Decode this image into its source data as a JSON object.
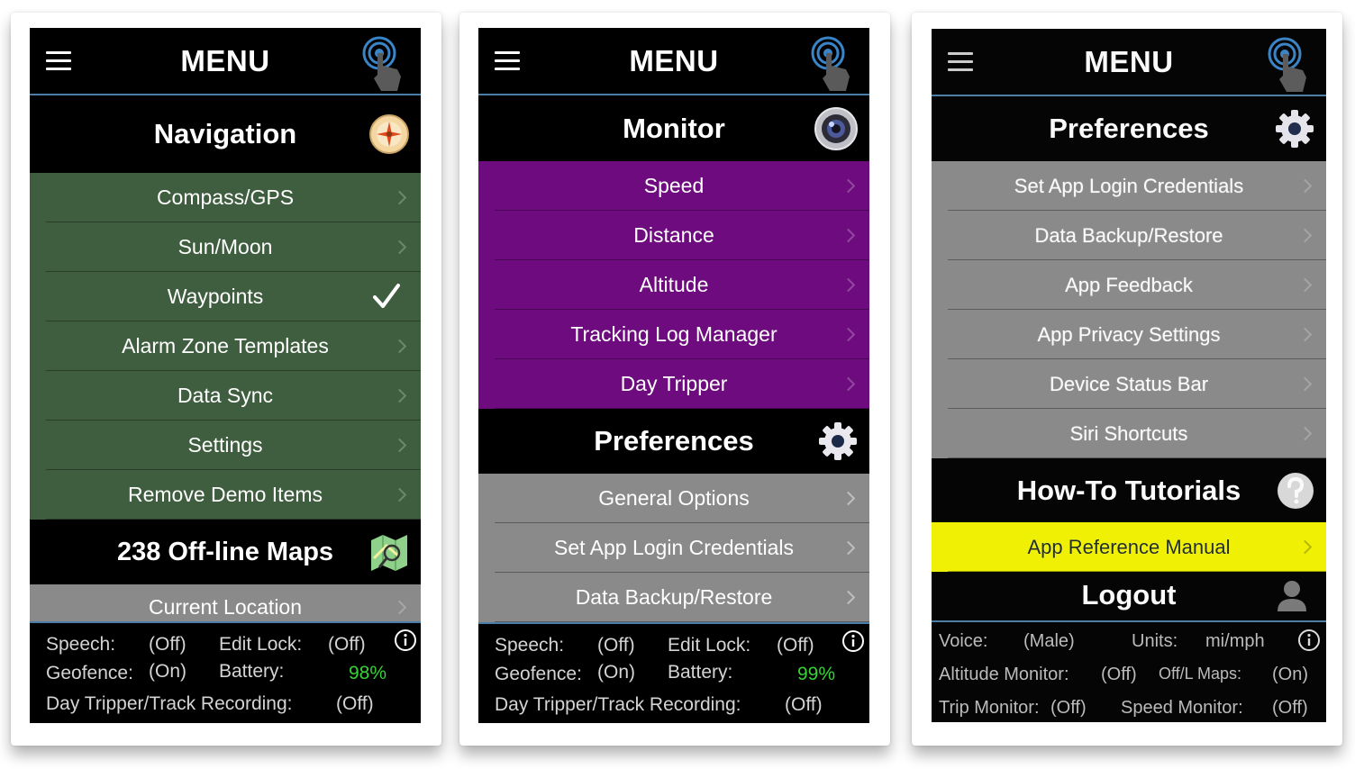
{
  "colors": {
    "navigation_rows": "#3f5e3f",
    "monitor_rows": "#6e0b7e",
    "preferences_rows": "#8a8a8a",
    "highlight_row": "#f5f500",
    "battery_text": "#36d236",
    "divider": "#4a7ea8"
  },
  "icons": {
    "menu": "hamburger-icon",
    "touch": "touch-pointer-icon",
    "navigation": "compass-icon",
    "monitor": "lens-icon",
    "preferences": "gear-icon",
    "maps": "map-icon",
    "tutorials": "question-icon",
    "logout": "user-icon",
    "info": "info-icon",
    "selected": "checkmark-icon"
  },
  "screen1": {
    "title": "MENU",
    "navigation": {
      "header": "Navigation",
      "items": [
        "Compass/GPS",
        "Sun/Moon",
        "Waypoints",
        "Alarm Zone Templates",
        "Data Sync",
        "Settings",
        "Remove Demo Items"
      ],
      "selected": "Waypoints"
    },
    "maps": {
      "header": "238 Off-line Maps",
      "items": [
        "Current Location"
      ]
    },
    "status": {
      "speech_label": "Speech:",
      "speech_value": "(Off)",
      "editlock_label": "Edit Lock:",
      "editlock_value": "(Off)",
      "geofence_label": "Geofence:",
      "geofence_value": "(On)",
      "battery_label": "Battery:",
      "battery_value": "98%",
      "daytripper_label": "Day Tripper/Track Recording:",
      "daytripper_value": "(Off)"
    }
  },
  "screen2": {
    "title": "MENU",
    "monitor": {
      "header": "Monitor",
      "items": [
        "Speed",
        "Distance",
        "Altitude",
        "Tracking Log Manager",
        "Day Tripper"
      ]
    },
    "preferences": {
      "header": "Preferences",
      "items": [
        "General Options",
        "Set App Login Credentials",
        "Data Backup/Restore"
      ]
    },
    "status": {
      "speech_label": "Speech:",
      "speech_value": "(Off)",
      "editlock_label": "Edit Lock:",
      "editlock_value": "(Off)",
      "geofence_label": "Geofence:",
      "geofence_value": "(On)",
      "battery_label": "Battery:",
      "battery_value": "99%",
      "daytripper_label": "Day Tripper/Track Recording:",
      "daytripper_value": "(Off)"
    }
  },
  "screen3": {
    "title": "MENU",
    "preferences": {
      "header": "Preferences",
      "items": [
        "Set App Login Credentials",
        "Data Backup/Restore",
        "App Feedback",
        "App Privacy Settings",
        "Device Status Bar",
        "Siri Shortcuts"
      ]
    },
    "tutorials": {
      "header": "How-To Tutorials",
      "items": [
        "App Reference Manual"
      ]
    },
    "logout": {
      "header": "Logout"
    },
    "status": {
      "voice_label": "Voice:",
      "voice_value": "(Male)",
      "units_label": "Units:",
      "units_value": "mi/mph",
      "altitude_label": "Altitude Monitor:",
      "altitude_value": "(Off)",
      "offmaps_label": "Off/L Maps:",
      "offmaps_value": "(On)",
      "trip_label": "Trip Monitor:",
      "trip_value": "(Off)",
      "speedmon_label": "Speed Monitor:",
      "speedmon_value": "(Off)"
    }
  }
}
